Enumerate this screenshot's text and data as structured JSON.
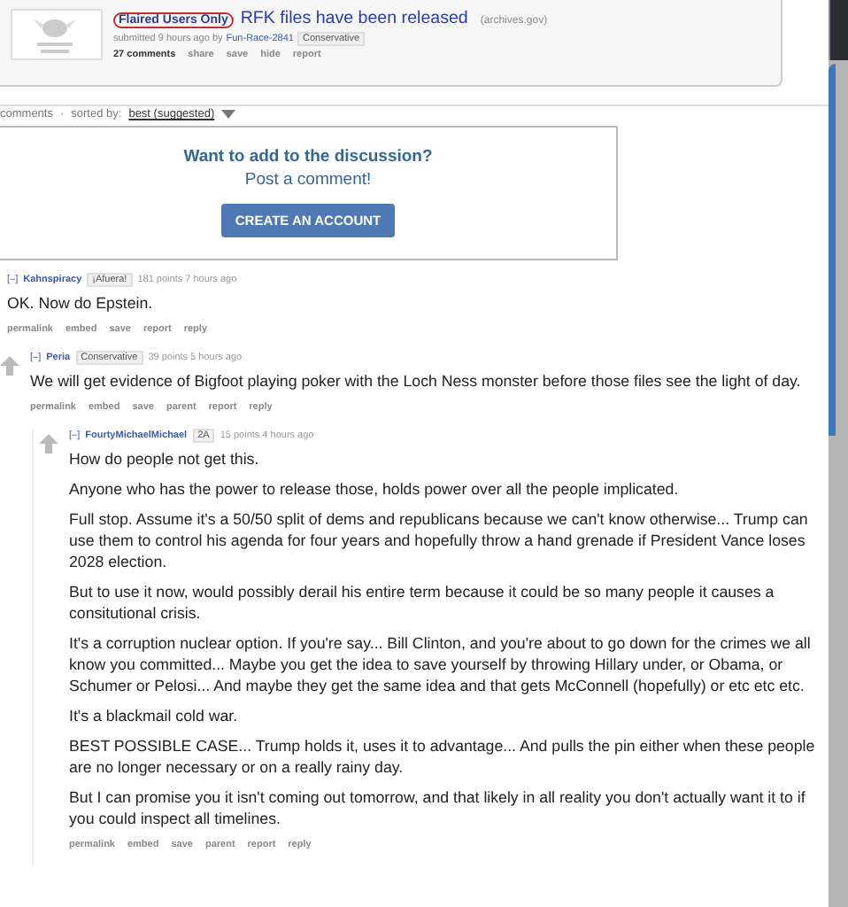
{
  "post": {
    "flair": "Flaired Users Only",
    "title": "RFK files have been released",
    "domain": "(archives.gov)",
    "submitted": "submitted 9 hours ago by",
    "author": "Fun-Race-2841",
    "author_flair": "Conservative",
    "actions": [
      "27 comments",
      "share",
      "save",
      "hide",
      "report"
    ]
  },
  "sort": {
    "label": "comments",
    "separator": "·",
    "sorted_by": "sorted by:",
    "value": "best (suggested)"
  },
  "prompt": {
    "heading": "Want to add to the discussion?",
    "subheading": "Post a comment!",
    "button": "CREATE AN ACCOUNT"
  },
  "comments": [
    {
      "toggle": "[–]",
      "author": "Kahnspiracy",
      "flair": "¡Afuera!",
      "meta": "181 points 7 hours ago",
      "paragraphs": [
        "OK. Now do Epstein."
      ],
      "actions": [
        "permalink",
        "embed",
        "save",
        "report",
        "reply"
      ],
      "children": [
        {
          "toggle": "[–]",
          "author": "Peria",
          "flair": "Conservative",
          "meta": "39 points 5 hours ago",
          "paragraphs": [
            "We will get evidence of Bigfoot playing poker with the Loch Ness monster before those files see the light of day."
          ],
          "actions": [
            "permalink",
            "embed",
            "save",
            "parent",
            "report",
            "reply"
          ],
          "children": [
            {
              "toggle": "[–]",
              "author": "FourtyMichaelMichael",
              "flair": "2A",
              "meta": "15 points 4 hours ago",
              "paragraphs": [
                "How do people not get this.",
                "Anyone who has the power to release those, holds power over all the people implicated.",
                "Full stop. Assume it's a 50/50 split of dems and republicans because we can't know otherwise... Trump can use them to control his agenda for four years and hopefully throw a hand grenade if President Vance loses 2028 election.",
                "But to use it now, would possibly derail his entire term because it could be so many people it causes a consitutional crisis.",
                "It's a corruption nuclear option. If you're say... Bill Clinton, and you're about to go down for the crimes we all know you committed... Maybe you get the idea to save yourself by throwing Hillary under, or Obama, or Schumer or Pelosi... And maybe they get the same idea and that gets McConnell (hopefully) or etc etc etc.",
                "It's a blackmail cold war.",
                "BEST POSSIBLE CASE... Trump holds it, uses it to advantage... And pulls the pin either when these people are no longer necessary or on a really rainy day.",
                "But I can promise you it isn't coming out tomorrow, and that likely in all reality you don't actually want it to if you could inspect all timelines."
              ],
              "actions": [
                "permalink",
                "embed",
                "save",
                "parent",
                "report",
                "reply"
              ]
            }
          ]
        }
      ]
    }
  ]
}
